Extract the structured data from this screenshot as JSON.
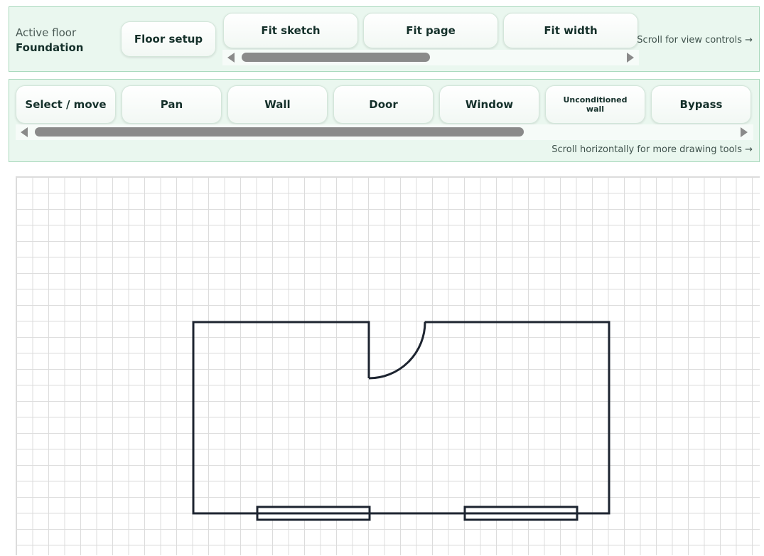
{
  "floor": {
    "label": "Active floor",
    "name": "Foundation"
  },
  "view_controls": {
    "floor_setup": "Floor setup",
    "buttons": [
      "Fit sketch",
      "Fit page",
      "Fit width"
    ],
    "hint": "Scroll for view controls →"
  },
  "drawing_tools": {
    "buttons": [
      "Select / move",
      "Pan",
      "Wall",
      "Door",
      "Window",
      "Unconditioned wall",
      "Bypass"
    ],
    "hint": "Scroll horizontally for more drawing tools →"
  },
  "sketch": {
    "elements": [
      "wall",
      "door",
      "window",
      "window"
    ]
  },
  "colors": {
    "panel_bg": "#eaf7ef",
    "panel_border": "#a9d9bd",
    "button_text": "#14302a",
    "grid": "#dcdcdc",
    "wall": "#1d2430"
  }
}
